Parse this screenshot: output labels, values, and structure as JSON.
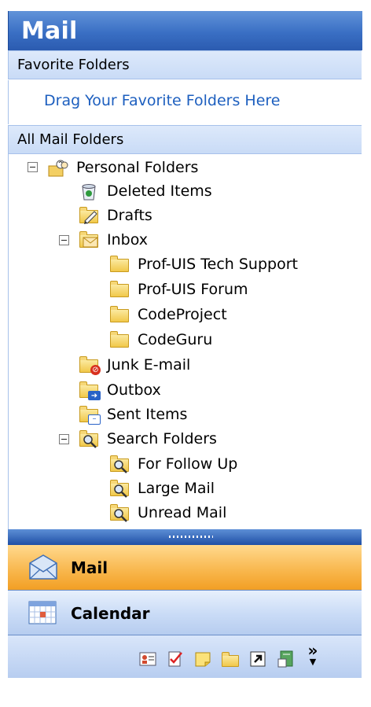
{
  "header": {
    "title": "Mail"
  },
  "favorites": {
    "header": "Favorite Folders",
    "hint": "Drag Your Favorite Folders Here"
  },
  "all_folders": {
    "header": "All Mail Folders",
    "tree": [
      {
        "label": "Personal Folders",
        "icon": "personal-folders-icon"
      },
      {
        "label": "Deleted Items",
        "icon": "deleted-items-icon"
      },
      {
        "label": "Drafts",
        "icon": "drafts-icon"
      },
      {
        "label": "Inbox",
        "icon": "inbox-icon"
      },
      {
        "label": "Prof-UIS Tech Support",
        "icon": "folder-icon"
      },
      {
        "label": "Prof-UIS Forum",
        "icon": "folder-icon"
      },
      {
        "label": "CodeProject",
        "icon": "folder-icon"
      },
      {
        "label": "CodeGuru",
        "icon": "folder-icon"
      },
      {
        "label": "Junk E-mail",
        "icon": "junk-email-icon"
      },
      {
        "label": "Outbox",
        "icon": "outbox-icon"
      },
      {
        "label": "Sent Items",
        "icon": "sent-items-icon"
      },
      {
        "label": "Search Folders",
        "icon": "search-folders-icon"
      },
      {
        "label": "For Follow Up",
        "icon": "search-folder-icon"
      },
      {
        "label": "Large Mail",
        "icon": "search-folder-icon"
      },
      {
        "label": "Unread Mail",
        "icon": "search-folder-icon"
      }
    ]
  },
  "nav_buttons": {
    "mail": "Mail",
    "calendar": "Calendar"
  },
  "bottom_toolbar": {
    "icons": [
      "contacts-icon",
      "tasks-icon",
      "notes-icon",
      "folder-list-icon",
      "shortcuts-icon",
      "journal-icon",
      "configure-buttons-icon"
    ],
    "overflow_glyph": "»"
  },
  "colors": {
    "header_blue": "#3a6fc4",
    "selected_orange": "#f8b54a",
    "link_blue": "#1d5fbf"
  }
}
